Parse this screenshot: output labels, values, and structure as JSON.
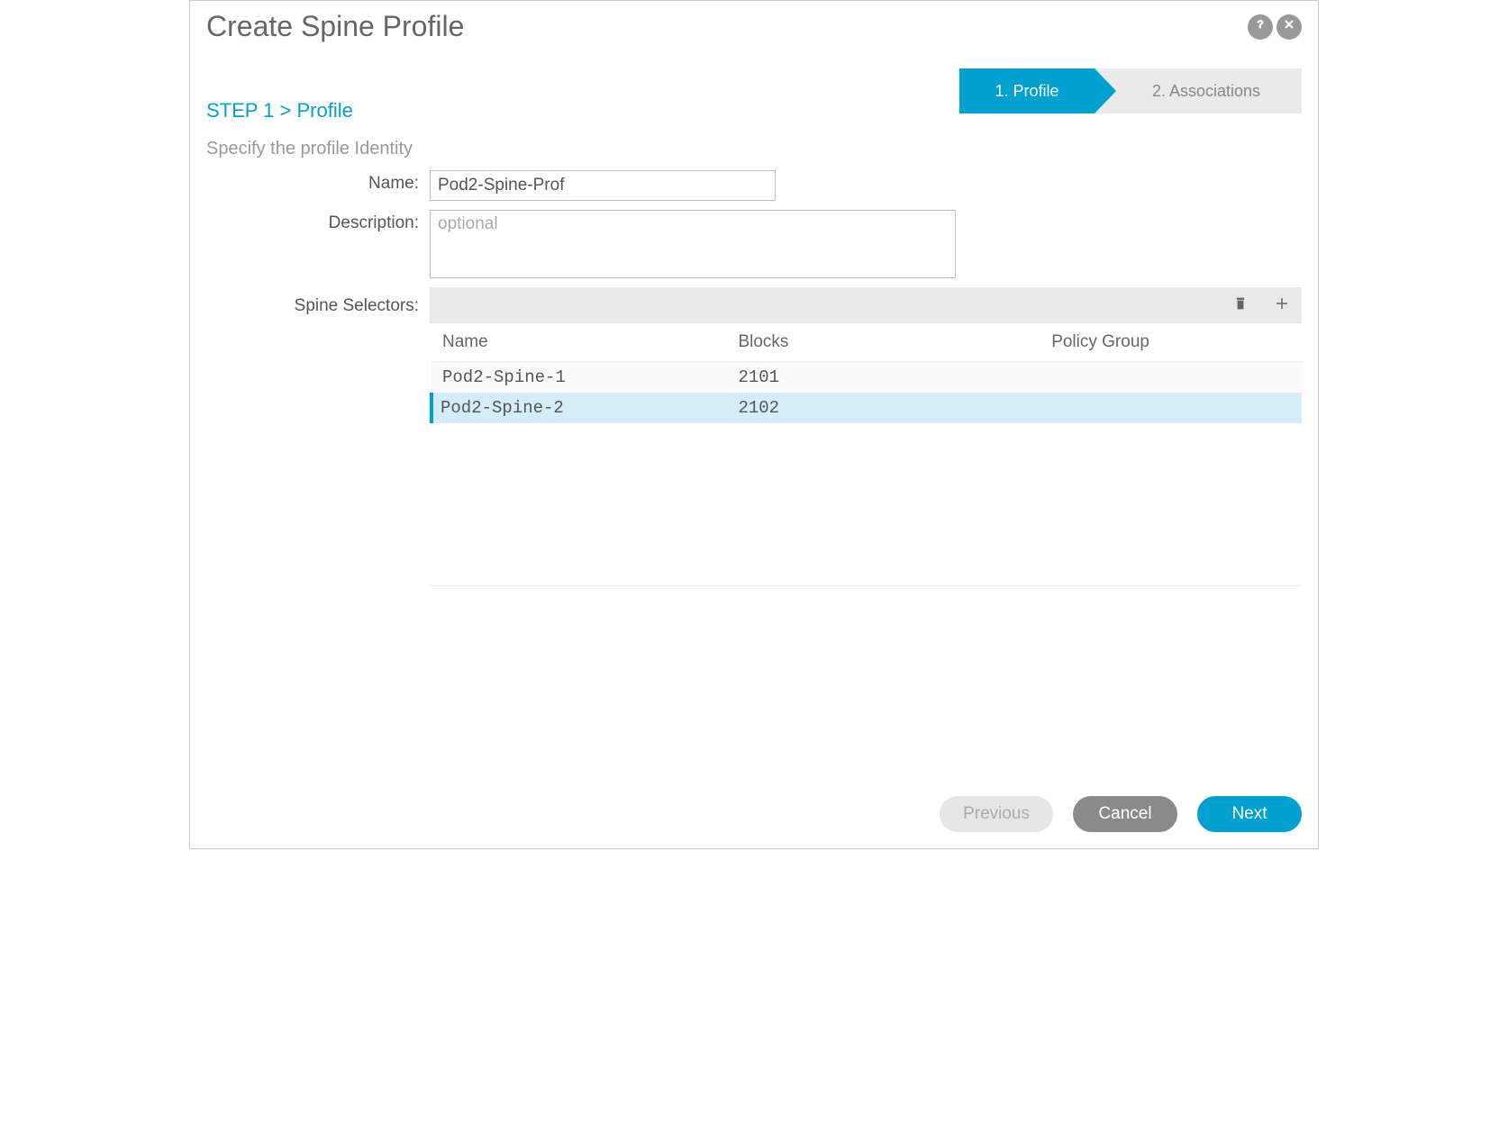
{
  "header": {
    "title": "Create Spine Profile"
  },
  "wizard": {
    "step1": "1. Profile",
    "step2": "2. Associations"
  },
  "step_indicator": "STEP 1 > Profile",
  "subheading": "Specify the profile Identity",
  "form": {
    "name_label": "Name:",
    "name_value": "Pod2-Spine-Prof",
    "description_label": "Description:",
    "description_value": "",
    "description_placeholder": "optional",
    "selectors_label": "Spine Selectors:"
  },
  "selectors_table": {
    "columns": {
      "name": "Name",
      "blocks": "Blocks",
      "policy_group": "Policy Group"
    },
    "rows": [
      {
        "name": "Pod2-Spine-1",
        "blocks": "2101",
        "policy_group": "",
        "selected": false
      },
      {
        "name": "Pod2-Spine-2",
        "blocks": "2102",
        "policy_group": "",
        "selected": true
      }
    ]
  },
  "footer": {
    "previous": "Previous",
    "cancel": "Cancel",
    "next": "Next"
  }
}
